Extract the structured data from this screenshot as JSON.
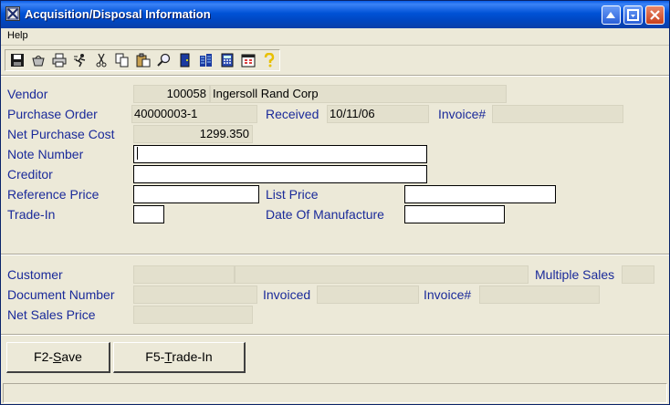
{
  "window": {
    "title": "Acquisition/Disposal Information"
  },
  "menu": {
    "help": "Help"
  },
  "toolbar": {
    "icons": [
      "save-icon",
      "basket-icon",
      "print-icon",
      "run-icon",
      "cut-icon",
      "copy-icon",
      "paste-icon",
      "find-icon",
      "door-icon",
      "building-icon",
      "calculator-icon",
      "calendar-icon",
      "help-icon"
    ]
  },
  "acquisition": {
    "vendor_label": "Vendor",
    "vendor_id": "100058",
    "vendor_name": "Ingersoll Rand Corp",
    "po_label": "Purchase Order",
    "po_value": "40000003-1",
    "received_label": "Received",
    "received_value": "10/11/06",
    "invoice_label": "Invoice#",
    "invoice_value": "",
    "net_cost_label": "Net Purchase Cost",
    "net_cost_value": "1299.350",
    "note_label": "Note Number",
    "note_value": "",
    "creditor_label": "Creditor",
    "creditor_value": "",
    "ref_price_label": "Reference Price",
    "ref_price_value": "",
    "list_price_label": "List Price",
    "list_price_value": "",
    "trade_in_label": "Trade-In",
    "trade_in_value": "",
    "dom_label": "Date Of Manufacture",
    "dom_value": ""
  },
  "disposal": {
    "customer_label": "Customer",
    "customer_id": "",
    "customer_name": "",
    "multiple_sales_label": "Multiple Sales",
    "multiple_sales_value": "",
    "doc_number_label": "Document Number",
    "doc_number_value": "",
    "invoiced_label": "Invoiced",
    "invoiced_value": "",
    "invoice_label": "Invoice#",
    "invoice_value": "",
    "net_sales_label": "Net Sales Price",
    "net_sales_value": ""
  },
  "buttons": {
    "save_prefix": "F2-",
    "save_key": "S",
    "save_rest": "ave",
    "tradein_prefix": "F5-",
    "tradein_key": "T",
    "tradein_rest": "rade-In"
  },
  "colors": {
    "label": "#1a2a9a",
    "titlebar": "#0052d6",
    "background": "#ece9d8"
  }
}
